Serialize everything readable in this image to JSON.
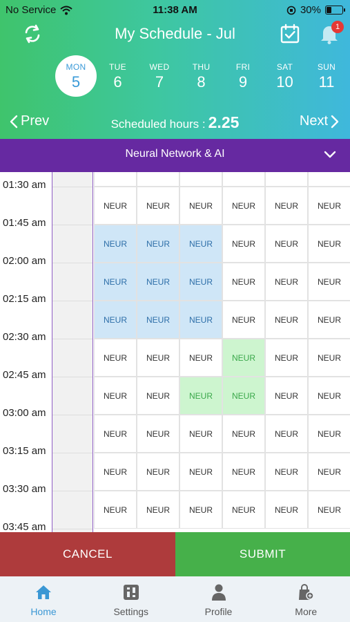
{
  "status": {
    "carrier": "No Service",
    "time": "11:38 AM",
    "battery": "30%",
    "battery_level": 0.3
  },
  "header": {
    "title": "My Schedule - Jul",
    "notification_count": "1"
  },
  "week": [
    {
      "name": "MON",
      "date": "5",
      "active": true
    },
    {
      "name": "TUE",
      "date": "6"
    },
    {
      "name": "WED",
      "date": "7"
    },
    {
      "name": "THU",
      "date": "8"
    },
    {
      "name": "FRI",
      "date": "9"
    },
    {
      "name": "SAT",
      "date": "10"
    },
    {
      "name": "SUN",
      "date": "11"
    }
  ],
  "nav": {
    "prev": "Prev",
    "next": "Next",
    "scheduled_label": "Scheduled hours :",
    "scheduled_value": "2.25"
  },
  "course": {
    "name": "Neural Network & AI"
  },
  "grid": {
    "times": [
      "01:30 am",
      "01:45 am",
      "02:00 am",
      "02:15 am",
      "02:30 am",
      "02:45 am",
      "03:00 am",
      "03:15 am",
      "03:30 am",
      "03:45 am"
    ],
    "cell_label": "NEUR",
    "rows": [
      [
        "n",
        "n",
        "n",
        "n",
        "n",
        "n"
      ],
      [
        "b",
        "b",
        "b",
        "n",
        "n",
        "n"
      ],
      [
        "b",
        "b",
        "b",
        "n",
        "n",
        "n"
      ],
      [
        "b",
        "b",
        "b",
        "n",
        "n",
        "n"
      ],
      [
        "n",
        "n",
        "n",
        "g",
        "n",
        "n"
      ],
      [
        "n",
        "n",
        "g",
        "g",
        "n",
        "n"
      ],
      [
        "n",
        "n",
        "n",
        "n",
        "n",
        "n"
      ],
      [
        "n",
        "n",
        "n",
        "n",
        "n",
        "n"
      ],
      [
        "n",
        "n",
        "n",
        "n",
        "n",
        "n"
      ]
    ]
  },
  "actions": {
    "cancel": "CANCEL",
    "submit": "SUBMIT"
  },
  "tabs": [
    {
      "label": "Home",
      "icon": "home-icon",
      "active": true
    },
    {
      "label": "Settings",
      "icon": "settings-icon"
    },
    {
      "label": "Profile",
      "icon": "profile-icon"
    },
    {
      "label": "More",
      "icon": "more-icon"
    }
  ],
  "colors": {
    "course_bar": "#6629a1",
    "cancel": "#ae3b3c",
    "submit": "#46b04a",
    "selected_blue": "#cfe6f7",
    "selected_green": "#cdf5cf"
  }
}
